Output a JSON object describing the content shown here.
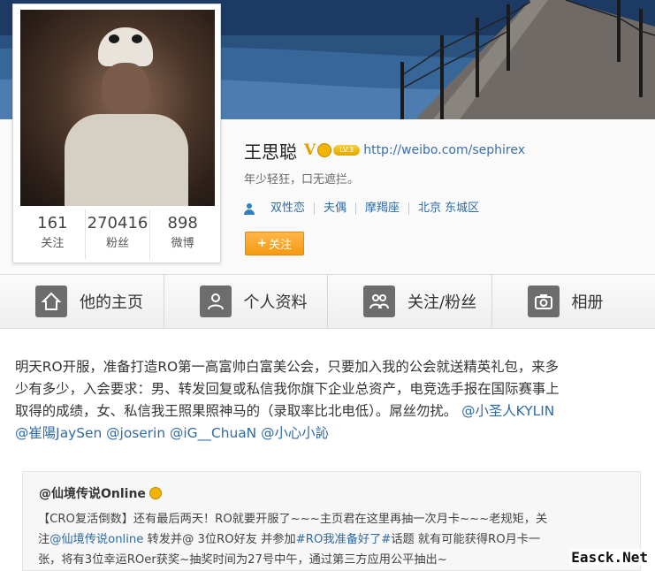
{
  "profile": {
    "name": "王思聪",
    "verified_badge": "V",
    "level_badge": "LV.3",
    "url": "http://weibo.com/sephirex",
    "bio": "年少轻狂，口无遮拦。",
    "tags": [
      "双性恋",
      "夫偶",
      "摩羯座",
      "北京 东城区"
    ],
    "follow_button": "关注",
    "stats": [
      {
        "value": "161",
        "label": "关注"
      },
      {
        "value": "270416",
        "label": "粉丝"
      },
      {
        "value": "898",
        "label": "微博"
      }
    ]
  },
  "tabs": [
    {
      "label": "他的主页",
      "icon": "home-icon"
    },
    {
      "label": "个人资料",
      "icon": "profile-icon"
    },
    {
      "label": "关注/粉丝",
      "icon": "follow-fans-icon"
    },
    {
      "label": "相册",
      "icon": "camera-icon"
    }
  ],
  "post": {
    "text_lines": [
      "明天RO开服，准备打造RO第一高富帅白富美公会，只要加入我的公会就送精英礼包，来多",
      "少有多少，入会要求：男、转发回复或私信我你旗下企业总资产，电竞选手报在国际赛事上",
      "取得的成绩，女、私信我王照果照神马的（录取率比北电低）。屌丝勿扰。"
    ],
    "mention_line3": "@小圣人KYLIN",
    "mentions_line4": [
      "@崔陽JaySen",
      "@joserin",
      "@iG__ChuaN",
      "@小心小訫"
    ]
  },
  "repost": {
    "author": "@仙境传说Online",
    "line1": "【CRO复活倒数】还有最后两天！RO就要开服了~~~主页君在这里再抽一次月卡~~~老规矩，关",
    "line2_a": "注",
    "line2_mention": "@仙境传说online",
    "line2_b": " 转发并@ 3位RO好友  并参加",
    "line2_hashtag": "#RO我准备好了#",
    "line2_c": "话题  就有可能获得RO月卡一",
    "line3": "张，将有3位幸运ROer获奖~抽奖时间为27号中午，通过第三方应用公平抽出~"
  },
  "watermark": "Easck.Net",
  "colors": {
    "link": "#2e6ba8",
    "follow_button": "#f59a12",
    "tab_icon": "#6d6d6d"
  }
}
